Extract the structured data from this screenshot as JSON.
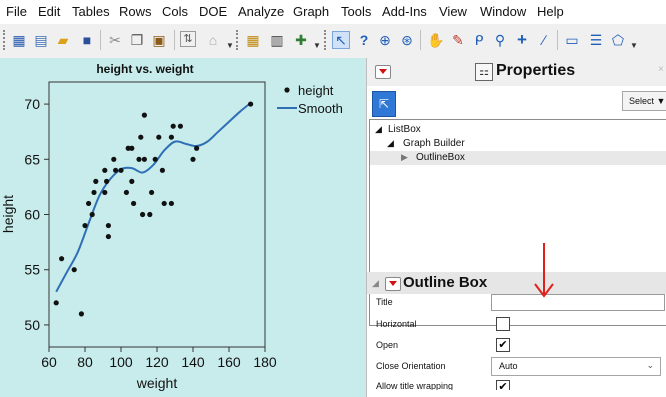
{
  "menubar": {
    "items": [
      "File",
      "Edit",
      "Tables",
      "Rows",
      "Cols",
      "DOE",
      "Analyze",
      "Graph",
      "Tools",
      "Add-Ins",
      "View",
      "Window",
      "Help"
    ]
  },
  "toolbar": {
    "icons": [
      "new-data-table-icon",
      "new-script-icon",
      "open-folder-icon",
      "save-icon",
      "cut-icon",
      "copy-icon",
      "paste-icon",
      "data-view-icon",
      "lock-icon",
      "grid-icon",
      "bar-chart-icon",
      "tree-icon",
      "arrow-cursor-icon",
      "help-pointer-icon",
      "crosshair-icon",
      "lasso-icon",
      "hand-icon",
      "brush-icon",
      "lasso-select-icon",
      "magnifier-icon",
      "plus-icon",
      "line-icon",
      "text-annotation-icon",
      "lines-icon",
      "polygon-icon"
    ]
  },
  "chart_data": {
    "type": "scatter",
    "title": "height vs. weight",
    "xlabel": "weight",
    "ylabel": "height",
    "xlim": [
      60,
      180
    ],
    "ylim": [
      48,
      72
    ],
    "xticks": [
      60,
      80,
      100,
      120,
      140,
      160,
      180
    ],
    "yticks": [
      50,
      55,
      60,
      65,
      70
    ],
    "legend_position": "right",
    "legend": [
      {
        "label": "height",
        "marker": "dot"
      },
      {
        "label": "Smooth",
        "marker": "line"
      }
    ],
    "point_color": "#111111",
    "smooth_color": "#2e6fb5",
    "background": "#c8ecec",
    "points": [
      [
        64,
        52
      ],
      [
        67,
        56
      ],
      [
        74,
        55
      ],
      [
        78,
        51
      ],
      [
        80,
        59
      ],
      [
        82,
        61
      ],
      [
        84,
        60
      ],
      [
        85,
        62
      ],
      [
        86,
        63
      ],
      [
        91,
        62
      ],
      [
        91,
        64
      ],
      [
        92,
        63
      ],
      [
        93,
        59
      ],
      [
        93,
        58
      ],
      [
        96,
        65
      ],
      [
        97,
        64
      ],
      [
        100,
        64
      ],
      [
        103,
        62
      ],
      [
        104,
        66
      ],
      [
        106,
        66
      ],
      [
        106,
        63
      ],
      [
        107,
        61
      ],
      [
        110,
        65
      ],
      [
        111,
        67
      ],
      [
        112,
        60
      ],
      [
        113,
        65
      ],
      [
        113,
        69
      ],
      [
        116,
        60
      ],
      [
        117,
        62
      ],
      [
        119,
        65
      ],
      [
        121,
        67
      ],
      [
        123,
        64
      ],
      [
        124,
        61
      ],
      [
        128,
        61
      ],
      [
        128,
        67
      ],
      [
        129,
        68
      ],
      [
        133,
        68
      ],
      [
        140,
        65
      ],
      [
        142,
        66
      ],
      [
        172,
        70
      ]
    ],
    "smooth": [
      [
        64,
        53
      ],
      [
        70,
        54.8
      ],
      [
        76,
        56.6
      ],
      [
        82,
        59.2
      ],
      [
        88,
        61.7
      ],
      [
        94,
        63.2
      ],
      [
        100,
        64.1
      ],
      [
        106,
        64.2
      ],
      [
        112,
        63.8
      ],
      [
        118,
        64.5
      ],
      [
        124,
        65.8
      ],
      [
        130,
        66.6
      ],
      [
        136,
        66.4
      ],
      [
        142,
        66.2
      ],
      [
        148,
        66.6
      ],
      [
        154,
        67.5
      ],
      [
        160,
        68.4
      ],
      [
        166,
        69.3
      ],
      [
        172,
        70.1
      ]
    ]
  },
  "properties": {
    "title": "Properties",
    "select_label": "Select",
    "tree": {
      "items": [
        "ListBox",
        "Graph Builder",
        "OutlineBox"
      ]
    },
    "outline": {
      "header": "Outline Box",
      "fields": {
        "title_label": "Title",
        "title_value": "",
        "horizontal_label": "Horizontal",
        "horizontal_checked": false,
        "open_label": "Open",
        "open_checked": true,
        "close_orientation_label": "Close Orientation",
        "close_orientation_value": "Auto",
        "allow_wrap_label": "Allow title wrapping",
        "allow_wrap_checked": true
      }
    },
    "annotation_arrow_color": "#e0201a"
  }
}
